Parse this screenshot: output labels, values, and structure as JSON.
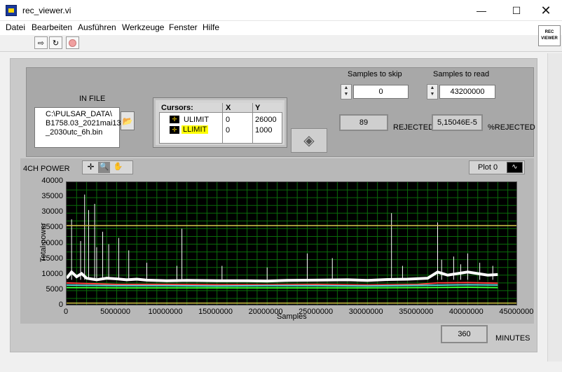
{
  "window": {
    "title": "rec_viewer.vi"
  },
  "menu": [
    "Datei",
    "Bearbeiten",
    "Ausführen",
    "Werkzeuge",
    "Fenster",
    "Hilfe"
  ],
  "toolbar": {
    "logo_line1": "REC",
    "logo_line2": "VIEWER"
  },
  "infile": {
    "label": "IN FILE",
    "path_line1": "C:\\PULSAR_DATA\\",
    "path_line2": "B1758.03_2021mai13",
    "path_line3": "_2030utc_6h.bin"
  },
  "cursors": {
    "headers": [
      "Cursors:",
      "X",
      "Y"
    ],
    "rows": [
      {
        "name": "ULIMIT",
        "x": "0",
        "y": "26000"
      },
      {
        "name": "LLIMIT",
        "x": "0",
        "y": "1000"
      }
    ]
  },
  "samples_to_skip": {
    "label": "Samples to skip",
    "value": "0"
  },
  "samples_to_read": {
    "label": "Samples to read",
    "value": "43200000"
  },
  "rejected": {
    "value": "89",
    "label": "REJECTED"
  },
  "pct_rejected": {
    "value": "5,15046E-5",
    "label": "%REJECTED"
  },
  "minutes": {
    "value": "360",
    "label": "MINUTES"
  },
  "graph": {
    "title": "4CH POWER",
    "plot_legend": "Plot 0"
  },
  "chart_data": {
    "type": "line",
    "title": "4CH POWER",
    "xlabel": "Samples",
    "ylabel": "Total power",
    "xlim": [
      0,
      45000000
    ],
    "ylim": [
      0,
      40000
    ],
    "x_ticks": [
      "0",
      "5000000",
      "10000000",
      "15000000",
      "20000000",
      "25000000",
      "30000000",
      "35000000",
      "40000000",
      "45000000"
    ],
    "y_ticks": [
      "0",
      "5000",
      "10000",
      "15000",
      "20000",
      "25000",
      "30000",
      "35000",
      "40000"
    ],
    "grid": true,
    "cursor_lines": [
      {
        "name": "ULIMIT",
        "y": 26000
      },
      {
        "name": "LLIMIT",
        "y": 1000
      }
    ],
    "series": [
      {
        "color": "#ffffff",
        "x": [
          0,
          500000,
          1000000,
          1500000,
          2000000,
          3000000,
          4000000,
          5000000,
          6000000,
          7000000,
          8000000,
          10000000,
          12000000,
          15000000,
          18000000,
          20000000,
          22000000,
          25000000,
          28000000,
          30000000,
          32000000,
          34000000,
          36000000,
          37000000,
          38000000,
          39000000,
          40000000,
          41000000,
          42000000,
          43000000
        ],
        "values": [
          9000,
          11000,
          9500,
          10500,
          9000,
          8500,
          9000,
          8800,
          8500,
          8700,
          8400,
          8200,
          8300,
          8200,
          8200,
          8100,
          8300,
          8400,
          8500,
          8300,
          8600,
          8700,
          9000,
          11000,
          10000,
          10500,
          11000,
          10500,
          10000,
          10200
        ]
      },
      {
        "color": "#ff3b3b",
        "x": [
          0,
          5000000,
          10000000,
          15000000,
          20000000,
          25000000,
          30000000,
          35000000,
          37000000,
          40000000,
          43000000
        ],
        "values": [
          7500,
          7000,
          7000,
          6900,
          6900,
          7000,
          6800,
          7000,
          7500,
          7600,
          7400
        ]
      },
      {
        "color": "#4fd3d3",
        "x": [
          0,
          5000000,
          10000000,
          15000000,
          20000000,
          25000000,
          30000000,
          35000000,
          40000000,
          43000000
        ],
        "values": [
          6800,
          6600,
          6600,
          6500,
          6600,
          6600,
          6500,
          6700,
          6900,
          6800
        ]
      },
      {
        "color": "#33ff33",
        "x": [
          0,
          5000000,
          10000000,
          15000000,
          20000000,
          25000000,
          30000000,
          35000000,
          40000000,
          43000000
        ],
        "values": [
          6000,
          5900,
          5900,
          5900,
          5900,
          5900,
          5900,
          6000,
          6100,
          6000
        ]
      }
    ],
    "spikes": [
      {
        "x": 500000,
        "y": 28000
      },
      {
        "x": 1400000,
        "y": 21000
      },
      {
        "x": 1800000,
        "y": 36000
      },
      {
        "x": 2200000,
        "y": 31000
      },
      {
        "x": 2800000,
        "y": 33000
      },
      {
        "x": 3000000,
        "y": 19000
      },
      {
        "x": 3600000,
        "y": 24000
      },
      {
        "x": 4200000,
        "y": 20000
      },
      {
        "x": 5200000,
        "y": 22000
      },
      {
        "x": 6200000,
        "y": 18000
      },
      {
        "x": 8000000,
        "y": 14000
      },
      {
        "x": 11000000,
        "y": 13000
      },
      {
        "x": 11500000,
        "y": 25000
      },
      {
        "x": 15500000,
        "y": 13000
      },
      {
        "x": 20000000,
        "y": 12500
      },
      {
        "x": 24000000,
        "y": 17000
      },
      {
        "x": 26500000,
        "y": 15500
      },
      {
        "x": 32400000,
        "y": 30000
      },
      {
        "x": 33500000,
        "y": 13000
      },
      {
        "x": 37000000,
        "y": 27000
      },
      {
        "x": 37400000,
        "y": 15000
      },
      {
        "x": 38600000,
        "y": 16000
      },
      {
        "x": 39300000,
        "y": 13500
      },
      {
        "x": 40000000,
        "y": 17000
      },
      {
        "x": 41200000,
        "y": 14000
      },
      {
        "x": 42500000,
        "y": 13000
      }
    ]
  }
}
